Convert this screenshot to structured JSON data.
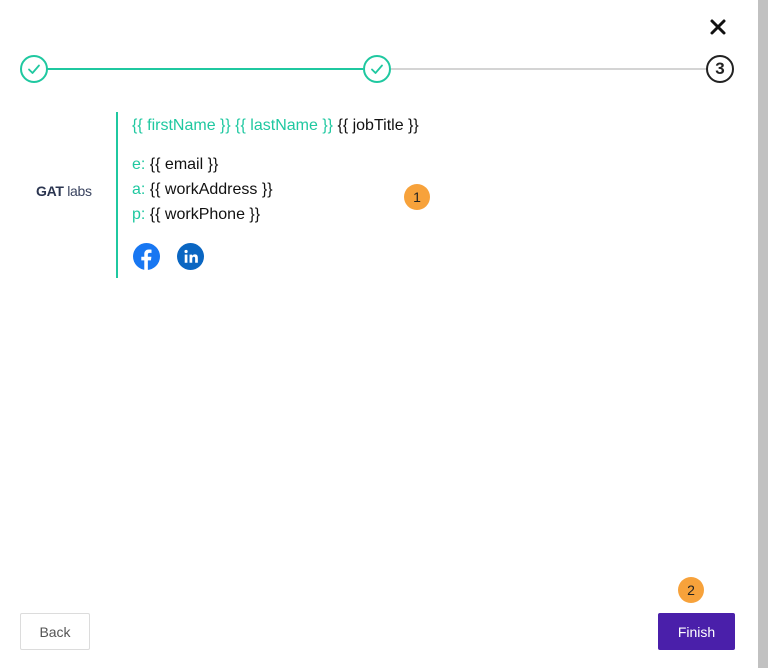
{
  "dialog": {
    "close_icon": "close-icon",
    "step3_number": "3"
  },
  "signature": {
    "logo_main": "GAT",
    "logo_sub": "labs",
    "first_name": "{{ firstName }}",
    "last_name": "{{ lastName }}",
    "job_title": "{{ jobTitle }}",
    "email_label": "e:",
    "email_value": "{{ email }}",
    "address_label": "a:",
    "address_value": "{{ workAddress }}",
    "phone_label": "p:",
    "phone_value": "{{ workPhone }}",
    "social_icons": [
      "facebook-icon",
      "linkedin-icon"
    ]
  },
  "badges": {
    "one": "1",
    "two": "2"
  },
  "footer": {
    "back_label": "Back",
    "finish_label": "Finish"
  },
  "colors": {
    "accent": "#1fc8a0",
    "primary_button": "#4a1faa",
    "badge": "#f7a23b",
    "facebook": "#1877f2",
    "linkedin": "#0a66c2"
  }
}
